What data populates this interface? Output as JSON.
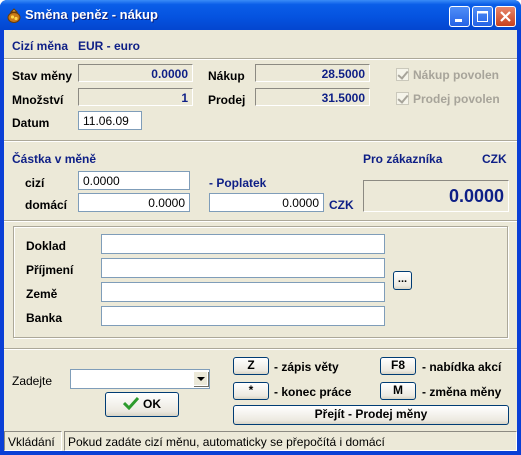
{
  "window": {
    "title": "Směna peněz - nákup"
  },
  "header": {
    "currency_label": "Cizí měna",
    "currency_value": "EUR - euro"
  },
  "rates": {
    "stav_label": "Stav měny",
    "stav_value": "0.0000",
    "mnozstvi_label": "Množství",
    "mnozstvi_value": "1",
    "datum_label": "Datum",
    "datum_value": "11.06.09",
    "nakup_label": "Nákup",
    "nakup_value": "28.5000",
    "prodej_label": "Prodej",
    "prodej_value": "31.5000",
    "nakup_povolen": "Nákup povolen",
    "prodej_povolen": "Prodej povolen"
  },
  "amount": {
    "section_label": "Částka v měně",
    "cizi_label": "cizí",
    "cizi_value": "0.0000",
    "domaci_label": "domácí",
    "domaci_value": "0.0000",
    "poplatek_label": "- Poplatek",
    "poplatek_value": "0.0000",
    "poplatek_currency": "CZK",
    "customer_label": "Pro zákazníka",
    "customer_currency": "CZK",
    "customer_value": "0.0000"
  },
  "document": {
    "doklad_label": "Doklad",
    "doklad_value": "",
    "prijmeni_label": "Příjmení",
    "prijmeni_value": "",
    "zeme_label": "Země",
    "zeme_value": "",
    "zeme_button": "...",
    "banka_label": "Banka",
    "banka_value": ""
  },
  "footer": {
    "zadejte_label": "Zadejte",
    "zadejte_value": "",
    "ok_label": "OK",
    "z_key": "Z",
    "z_desc": "- zápis věty",
    "star_key": "*",
    "star_desc": "- konec práce",
    "f8_key": "F8",
    "f8_desc": "- nabídka akcí",
    "m_key": "M",
    "m_desc": "- změna měny",
    "switch_button": "Přejít - Prodej měny"
  },
  "status": {
    "mode": "Vkládání",
    "message": "Pokud zadáte cizí měnu, automaticky se přepočítá i domácí"
  },
  "colors": {
    "label_blue": "#0e1f86",
    "titlebar": "#0553e0",
    "ok_check": "#2d9b2d"
  }
}
